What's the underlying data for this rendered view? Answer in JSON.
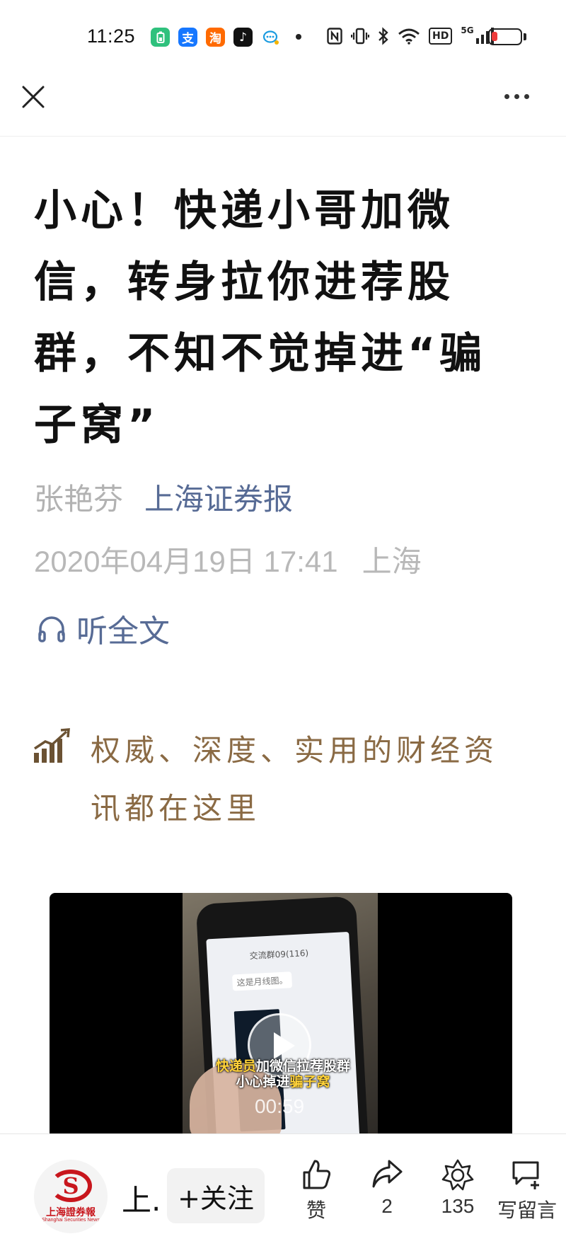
{
  "status_bar": {
    "time": "11:25",
    "app_icons": [
      {
        "name": "battery-app-icon",
        "glyph": "",
        "color": "#2fc17d"
      },
      {
        "name": "alipay-icon",
        "glyph": "支",
        "color": "#1677ff"
      },
      {
        "name": "taobao-icon",
        "glyph": "淘",
        "color": "#ff6a00"
      },
      {
        "name": "tiktok-icon",
        "glyph": "♪",
        "color": "#111111"
      },
      {
        "name": "chat-bubble-icon",
        "glyph": "",
        "color": "#ffffff"
      }
    ],
    "network_badge": "HD",
    "signal_badge": "5G",
    "battery_level": 0.2,
    "battery_color": "#ee3b3b"
  },
  "nav": {
    "close_icon": "close-icon",
    "more_icon": "more-icon"
  },
  "article": {
    "title": "小心！快递小哥加微信，转身拉你进荐股群，不知不觉掉进“骗子窝”",
    "author": "张艳芬",
    "account": "上海证券报",
    "date": "2020年04月19日 17:41",
    "location": "上海",
    "listen_label": "听全文",
    "promo_text": "权威、深度、实用的财经资讯都在这里"
  },
  "video": {
    "chat_title": "交流群09(116)",
    "chat_msg": "这是月线图。",
    "caption_line1_a": "快递员",
    "caption_line1_b": "加微信拉荐股群",
    "caption_line2_a": "小心掉进",
    "caption_line2_b": "骗子窝",
    "duration": "00:59"
  },
  "bottom_bar": {
    "logo_text": "上海證券報",
    "logo_sub": "Shanghai Securities News",
    "account_short": "上.",
    "follow_label": "+关注",
    "like_label": "赞",
    "share_count": "2",
    "favorite_count": "135",
    "comment_label": "写留言"
  },
  "colors": {
    "link": "#576b95",
    "meta_gray": "#b8b8b8",
    "promo_brown": "#8a6a44",
    "brand_red": "#c8161d"
  }
}
